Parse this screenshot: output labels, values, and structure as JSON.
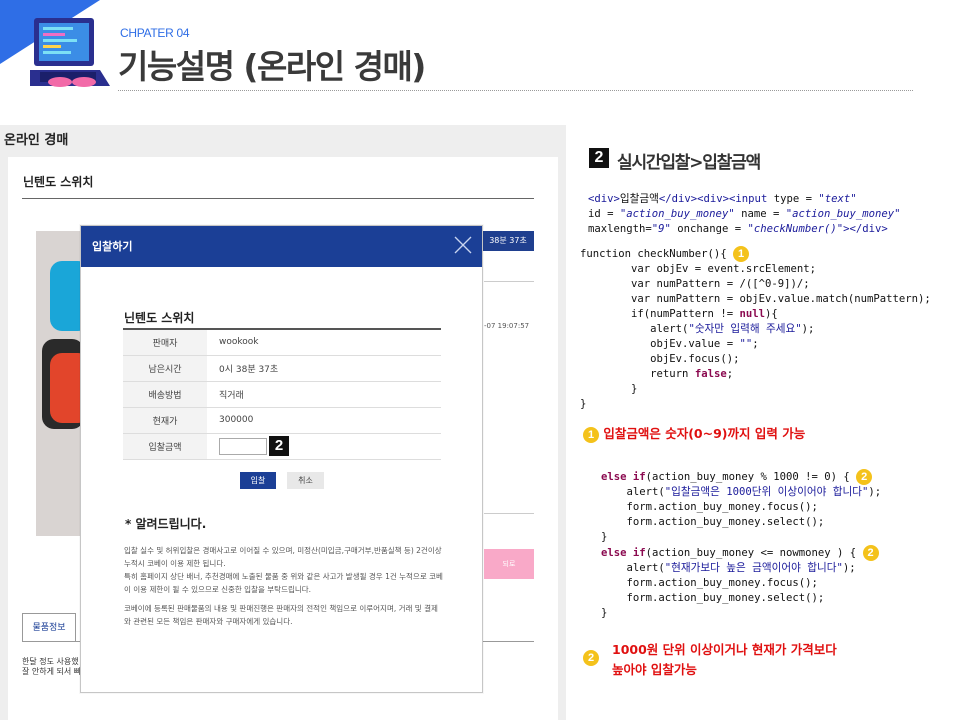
{
  "header": {
    "chapter": "CHPATER 04",
    "title": "기능설명 (온라인 경매)"
  },
  "screenshot": {
    "page_heading": "온라인 경매",
    "product_title": "닌텐도 스위치",
    "time_badge": "38분 37초",
    "date_text": "-07 19:07:57",
    "pink_button": "되로",
    "product_tab": "물품정보",
    "footer_note_line1": "한달 정도 사용했",
    "footer_note_line2": "잘 안하게 되서 빠르게 처분합니다."
  },
  "modal": {
    "title": "입찰하기",
    "item_title": "닌텐도 스위치",
    "rows": [
      {
        "label": "판매자",
        "value": "wookook"
      },
      {
        "label": "남은시간",
        "value": "0시 38분 37초"
      },
      {
        "label": "배송방법",
        "value": "직거래"
      },
      {
        "label": "현재가",
        "value": "300000"
      },
      {
        "label": "입찰금액",
        "value": ""
      }
    ],
    "badge": "2",
    "bid_button": "입찰",
    "cancel_button": "취소",
    "notice_title": "* 알려드립니다.",
    "notice_p1_l1": "입찰 실수 및 허위입찰은 경매사고로 이어질 수 있으며, 미정산(미입금,구매거부,반품실책 등) 2건이상",
    "notice_p1_l2": "누적시 코베이 이용 제한 됩니다.",
    "notice_p1_l3": "특히 홈페이지 상단 배너, 추천경매에 노출된 물품 중 위와 같은 사고가 발생될 경우 1건 누적으로 코베",
    "notice_p1_l4": "이 이용 제한이 될 수 있으므로 신중한 입찰을 부탁드립니다.",
    "notice_p2_l1": "코베이에 등록된 판매물품의 내용 및 판매진행은 판매자의 전적인 책임으로 이루어지며, 거래 및 결제",
    "notice_p2_l2": "와 관련된 모든 책임은 판매자와 구매자에게 있습니다."
  },
  "explain": {
    "section_number": "2",
    "section_title": "실시간입찰>입찰금액",
    "circle1": "1",
    "circle2": "2",
    "note1": "입찰금액은 숫자(0~9)까지 입력 가능",
    "note2_line1": "1000원 단위 이상이거나 현재가 가격보다",
    "note2_line2": "높아야 입찰가능",
    "code": {
      "html_l1_a": "<div>",
      "html_l1_b": "입찰금액",
      "html_l1_c": "</div><div><input ",
      "html_l1_d": "type = ",
      "html_l1_e": "\"text\"",
      "html_l2_a": "id = ",
      "html_l2_b": "\"action_buy_money\"",
      "html_l2_c": " name = ",
      "html_l2_d": "\"action_buy_money\"",
      "html_l3_a": "maxlength=",
      "html_l3_b": "\"9\"",
      "html_l3_c": " onchange = ",
      "html_l3_d": "\"checkNumber()\"",
      "html_l3_e": "></div>",
      "fn_l1": "function checkNumber(){ ",
      "fn_l2": "        var objEv = event.srcElement;",
      "fn_l3": "        var numPattern = /([^0-9])/;",
      "fn_l4": "        var numPattern = objEv.value.match(numPattern);",
      "fn_l5_a": "        if(numPattern != ",
      "fn_l5_b": "null",
      "fn_l5_c": "){",
      "fn_l6_a": "           alert(",
      "fn_l6_b": "\"숫자만 입력해 주세요\"",
      "fn_l6_c": ");",
      "fn_l7_a": "           objEv.value = ",
      "fn_l7_b": "\"\"",
      "fn_l7_c": ";",
      "fn_l8": "           objEv.focus();",
      "fn_l9_a": "           return ",
      "fn_l9_b": "false",
      "fn_l9_c": ";",
      "fn_l10": "        }",
      "fn_l11": "}",
      "el_l1_a": "else if",
      "el_l1_b": "(action_buy_money % 1000 != 0) { ",
      "el_l2_a": "    alert(",
      "el_l2_b": "\"입찰금액은 1000단위 이상이어야 합니다\"",
      "el_l2_c": ");",
      "el_l3": "    form.action_buy_money.focus();",
      "el_l4": "    form.action_buy_money.select();",
      "el_l5": "}",
      "el_l6_a": "else if",
      "el_l6_b": "(action_buy_money <= nowmoney ) { ",
      "el_l7_a": "    alert(",
      "el_l7_b": "\"현재가보다 높은 금액이어야 합니다\"",
      "el_l7_c": ");",
      "el_l8": "    form.action_buy_money.focus();",
      "el_l9": "    form.action_buy_money.select();",
      "el_l10": "}"
    }
  },
  "colors": {
    "accent_blue": "#2f6ee6",
    "modal_navy": "#1b3f96",
    "note_red": "#e01010",
    "circle_yellow": "#f4c21b"
  }
}
